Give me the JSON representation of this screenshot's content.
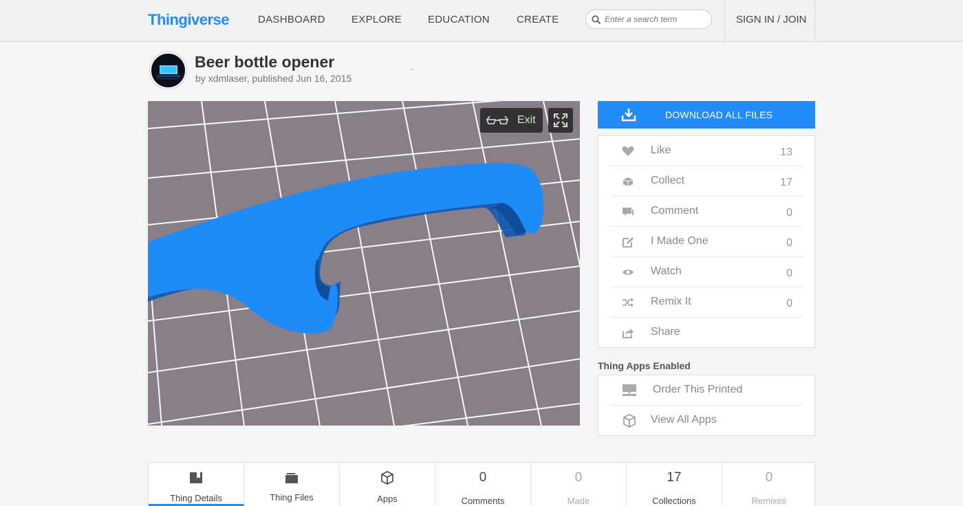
{
  "header": {
    "logo": "Thingiverse",
    "nav": [
      "DASHBOARD",
      "EXPLORE",
      "EDUCATION",
      "CREATE"
    ],
    "search_placeholder": "Enter a search term",
    "signin": "SIGN IN / JOIN"
  },
  "thing": {
    "title": "Beer bottle opener",
    "byline": "by xdmlaser, published Jun 16, 2015",
    "tick": "-"
  },
  "viewer": {
    "exit_label": "Exit",
    "background_color": "#887f89",
    "model_color": "#1e8bf9"
  },
  "download": {
    "label": "DOWNLOAD ALL FILES"
  },
  "actions": [
    {
      "icon": "heart-icon",
      "label": "Like",
      "count": "13"
    },
    {
      "icon": "collect-icon",
      "label": "Collect",
      "count": "17"
    },
    {
      "icon": "comment-icon",
      "label": "Comment",
      "count": "0"
    },
    {
      "icon": "made-one-icon",
      "label": "I Made One",
      "count": "0"
    },
    {
      "icon": "eye-icon",
      "label": "Watch",
      "count": "0"
    },
    {
      "icon": "remix-icon",
      "label": "Remix It",
      "count": "0"
    },
    {
      "icon": "share-icon",
      "label": "Share",
      "count": ""
    }
  ],
  "apps": {
    "heading": "Thing Apps Enabled",
    "items": [
      {
        "icon": "printer-icon",
        "label": "Order This Printed"
      },
      {
        "icon": "cube-icon",
        "label": "View All Apps"
      }
    ]
  },
  "tabs": [
    {
      "label": "Thing Details",
      "icon": "thing-details-icon",
      "active": true
    },
    {
      "label": "Thing Files",
      "icon": "thing-files-icon"
    },
    {
      "label": "Apps",
      "icon": "apps-cube-icon"
    },
    {
      "label": "Comments",
      "count": "0"
    },
    {
      "label": "Made",
      "count": "0",
      "dim": true
    },
    {
      "label": "Collections",
      "count": "17"
    },
    {
      "label": "Remixes",
      "count": "0",
      "dim": true
    }
  ],
  "colors": {
    "accent": "#248bfb"
  }
}
